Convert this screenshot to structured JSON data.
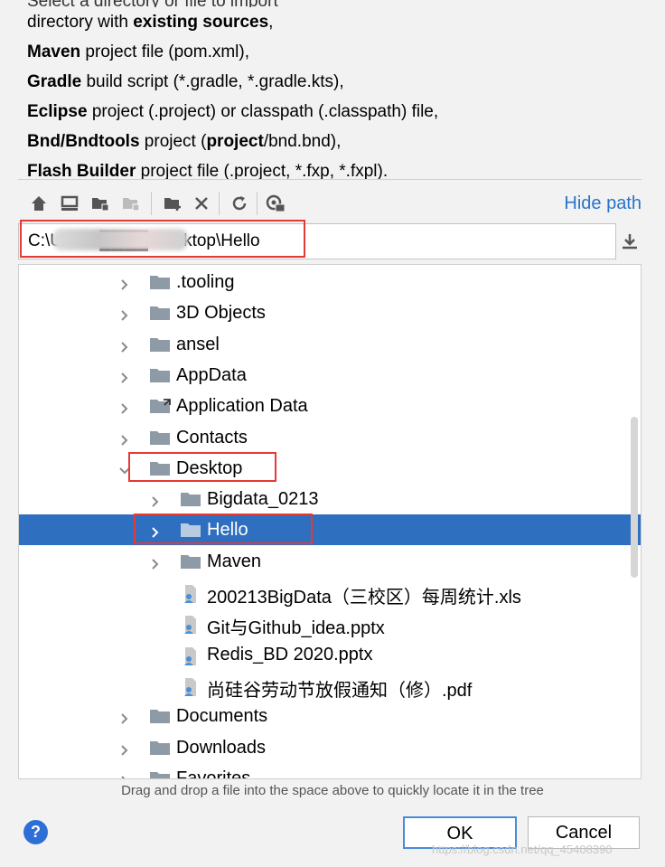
{
  "description": {
    "top_partial": "Select a directory or file to import",
    "lines": [
      {
        "b1": "",
        "t1": "directory with ",
        "b2": "existing sources",
        "t2": ","
      },
      {
        "b1": "Maven",
        "t1": " project file (pom.xml),",
        "b2": "",
        "t2": ""
      },
      {
        "b1": "Gradle",
        "t1": " build script (*.gradle, *.gradle.kts),",
        "b2": "",
        "t2": ""
      },
      {
        "b1": "Eclipse",
        "t1": " project (.project) or classpath (.classpath) file,",
        "b2": "",
        "t2": ""
      },
      {
        "b1": "Bnd/Bndtools",
        "t1": " project (",
        "b2": "project",
        "t2": "/bnd.bnd),"
      },
      {
        "b1": "Flash Builder",
        "t1": " project file (.project, *.fxp, *.fxpl).",
        "b2": "",
        "t2": ""
      }
    ]
  },
  "toolbar": {
    "icons": [
      "home-icon",
      "desktop-icon",
      "project-folder-icon",
      "module-folder-icon",
      "new-folder-icon",
      "delete-icon",
      "refresh-icon",
      "show-hidden-icon"
    ],
    "hide_path": "Hide path"
  },
  "path": {
    "value": "C:\\Users\\████\\Desktop\\Hello"
  },
  "tree": {
    "rows": [
      {
        "label": ".tooling",
        "type": "folder",
        "level": 0,
        "expander": "collapsed"
      },
      {
        "label": "3D Objects",
        "type": "folder",
        "level": 0,
        "expander": "collapsed"
      },
      {
        "label": "ansel",
        "type": "folder",
        "level": 0,
        "expander": "collapsed"
      },
      {
        "label": "AppData",
        "type": "folder",
        "level": 0,
        "expander": "collapsed"
      },
      {
        "label": "Application Data",
        "type": "link-folder",
        "level": 0,
        "expander": "collapsed"
      },
      {
        "label": "Contacts",
        "type": "folder",
        "level": 0,
        "expander": "collapsed"
      },
      {
        "label": "Desktop",
        "type": "folder",
        "level": 0,
        "expander": "expanded"
      },
      {
        "label": "Bigdata_0213",
        "type": "folder",
        "level": 1,
        "expander": "collapsed"
      },
      {
        "label": "Hello",
        "type": "folder",
        "level": 1,
        "expander": "collapsed",
        "selected": true
      },
      {
        "label": "Maven",
        "type": "folder",
        "level": 1,
        "expander": "collapsed"
      },
      {
        "label": "200213BigData（三校区）每周统计.xls",
        "type": "file",
        "level": 1,
        "expander": "none"
      },
      {
        "label": "Git与Github_idea.pptx",
        "type": "file",
        "level": 1,
        "expander": "none"
      },
      {
        "label": "Redis_BD 2020.pptx",
        "type": "file",
        "level": 1,
        "expander": "none"
      },
      {
        "label": "尚硅谷劳动节放假通知（修）.pdf",
        "type": "file",
        "level": 1,
        "expander": "none"
      },
      {
        "label": "Documents",
        "type": "folder",
        "level": 0,
        "expander": "collapsed"
      },
      {
        "label": "Downloads",
        "type": "folder",
        "level": 0,
        "expander": "collapsed"
      },
      {
        "label": "Favorites",
        "type": "folder",
        "level": 0,
        "expander": "collapsed"
      }
    ]
  },
  "hint": "Drag and drop a file into the space above to quickly locate it in the tree",
  "buttons": {
    "help": "?",
    "ok": "OK",
    "cancel": "Cancel"
  },
  "watermark": "https://blog.csdn.net/qq_45408390",
  "colors": {
    "selection": "#2f6fbf",
    "link": "#2874c8",
    "highlight_box": "#e53935",
    "folder": "#8e9aa6"
  }
}
